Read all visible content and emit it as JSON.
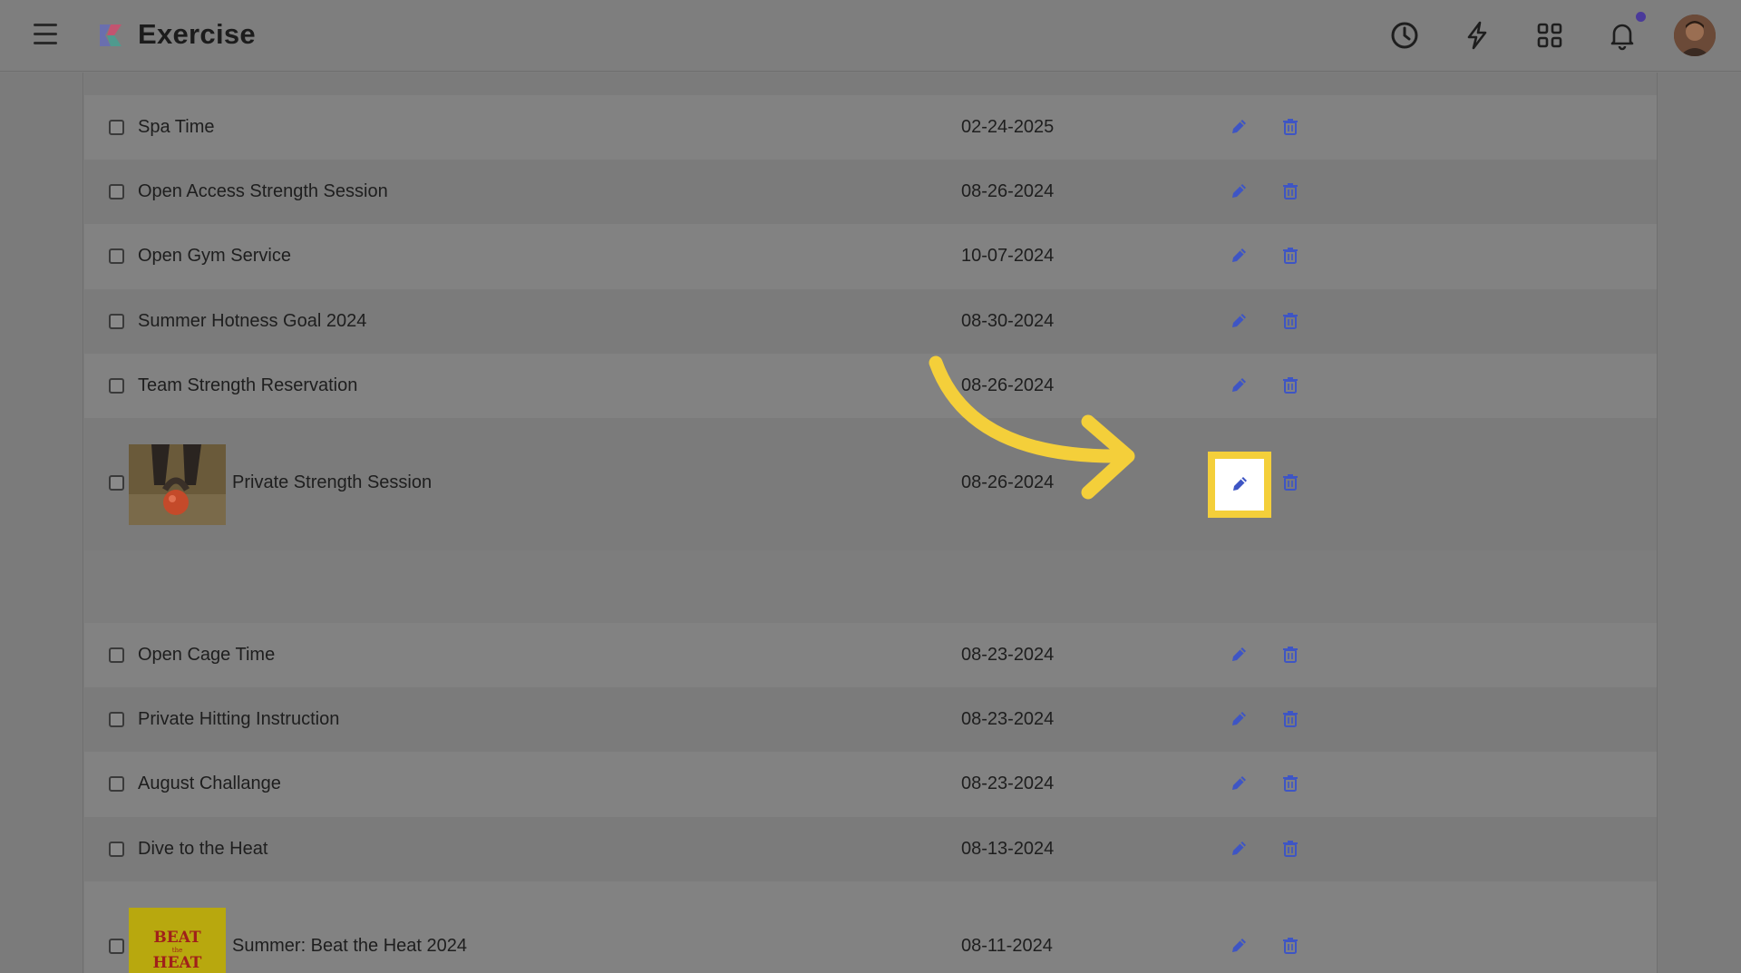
{
  "header": {
    "title": "Exercise",
    "icons": [
      "menu-icon",
      "clock-icon",
      "lightning-icon",
      "apps-grid-icon",
      "bell-icon"
    ],
    "notification_dot_color": "#4a3a9a"
  },
  "rows": [
    {
      "name": "Spa Time",
      "date": "02-24-2025"
    },
    {
      "name": "Open Access Strength Session",
      "date": "08-26-2024"
    },
    {
      "name": "Open Gym Service",
      "date": "10-07-2024"
    },
    {
      "name": "Summer Hotness Goal 2024",
      "date": "08-30-2024"
    },
    {
      "name": "Team Strength Reservation",
      "date": "08-26-2024"
    },
    {
      "name": "Private Strength Session",
      "date": "08-26-2024",
      "thumbnail": "kettlebell-image"
    },
    {
      "name": "Open Cage Time",
      "date": "08-23-2024"
    },
    {
      "name": "Private Hitting Instruction",
      "date": "08-23-2024"
    },
    {
      "name": "August Challange",
      "date": "08-23-2024"
    },
    {
      "name": "Dive to the Heat",
      "date": "08-13-2024"
    },
    {
      "name": "Summer: Beat the Heat 2024",
      "date": "08-11-2024",
      "thumbnail": "beat-the-heat-image"
    }
  ],
  "thumbnail_text": {
    "beat": "BEAT",
    "the": "the",
    "heat": "HEAT"
  },
  "colors": {
    "action_icon": "#3e55c4",
    "annotation": "#f4cf3a"
  }
}
